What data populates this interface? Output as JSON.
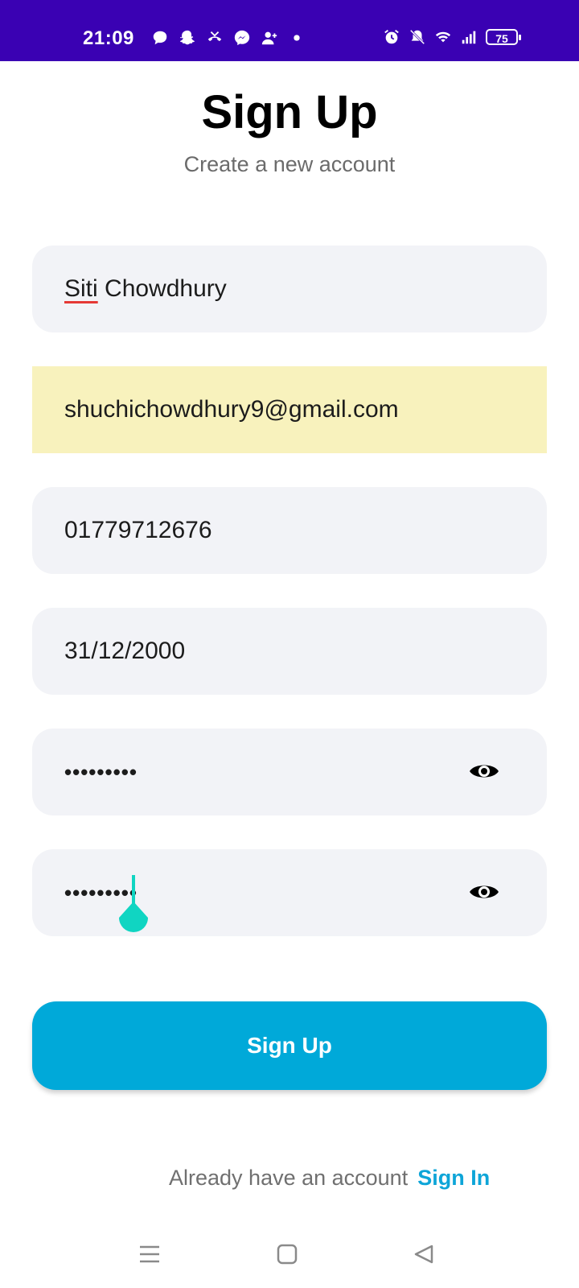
{
  "status_bar": {
    "time": "21:09",
    "notification_icons": [
      "chat-bubble-icon",
      "snapchat-icon",
      "missed-call-icon",
      "messenger-icon",
      "add-contact-icon",
      "dot-icon"
    ],
    "system_icons": [
      "alarm-icon",
      "mute-icon",
      "wifi-icon",
      "signal-icon"
    ],
    "battery": "75",
    "background": "#3a01b3"
  },
  "header": {
    "title": "Sign Up",
    "subtitle": "Create a new account"
  },
  "form": {
    "name_value_first": "Siti",
    "name_value_rest": " Chowdhury",
    "email_value": "shuchichowdhury9@gmail.com",
    "phone_value": "01779712676",
    "dob_value": "31/12/2000",
    "password_value": "•••••••••",
    "confirm_password_value": "•••••••••",
    "submit_label": "Sign Up",
    "accent": "#00a9d9"
  },
  "footer": {
    "prompt": "Already have an account",
    "link": "Sign In"
  },
  "nav_bar": {
    "icons": [
      "menu-icon",
      "home-square-icon",
      "back-triangle-icon"
    ]
  }
}
